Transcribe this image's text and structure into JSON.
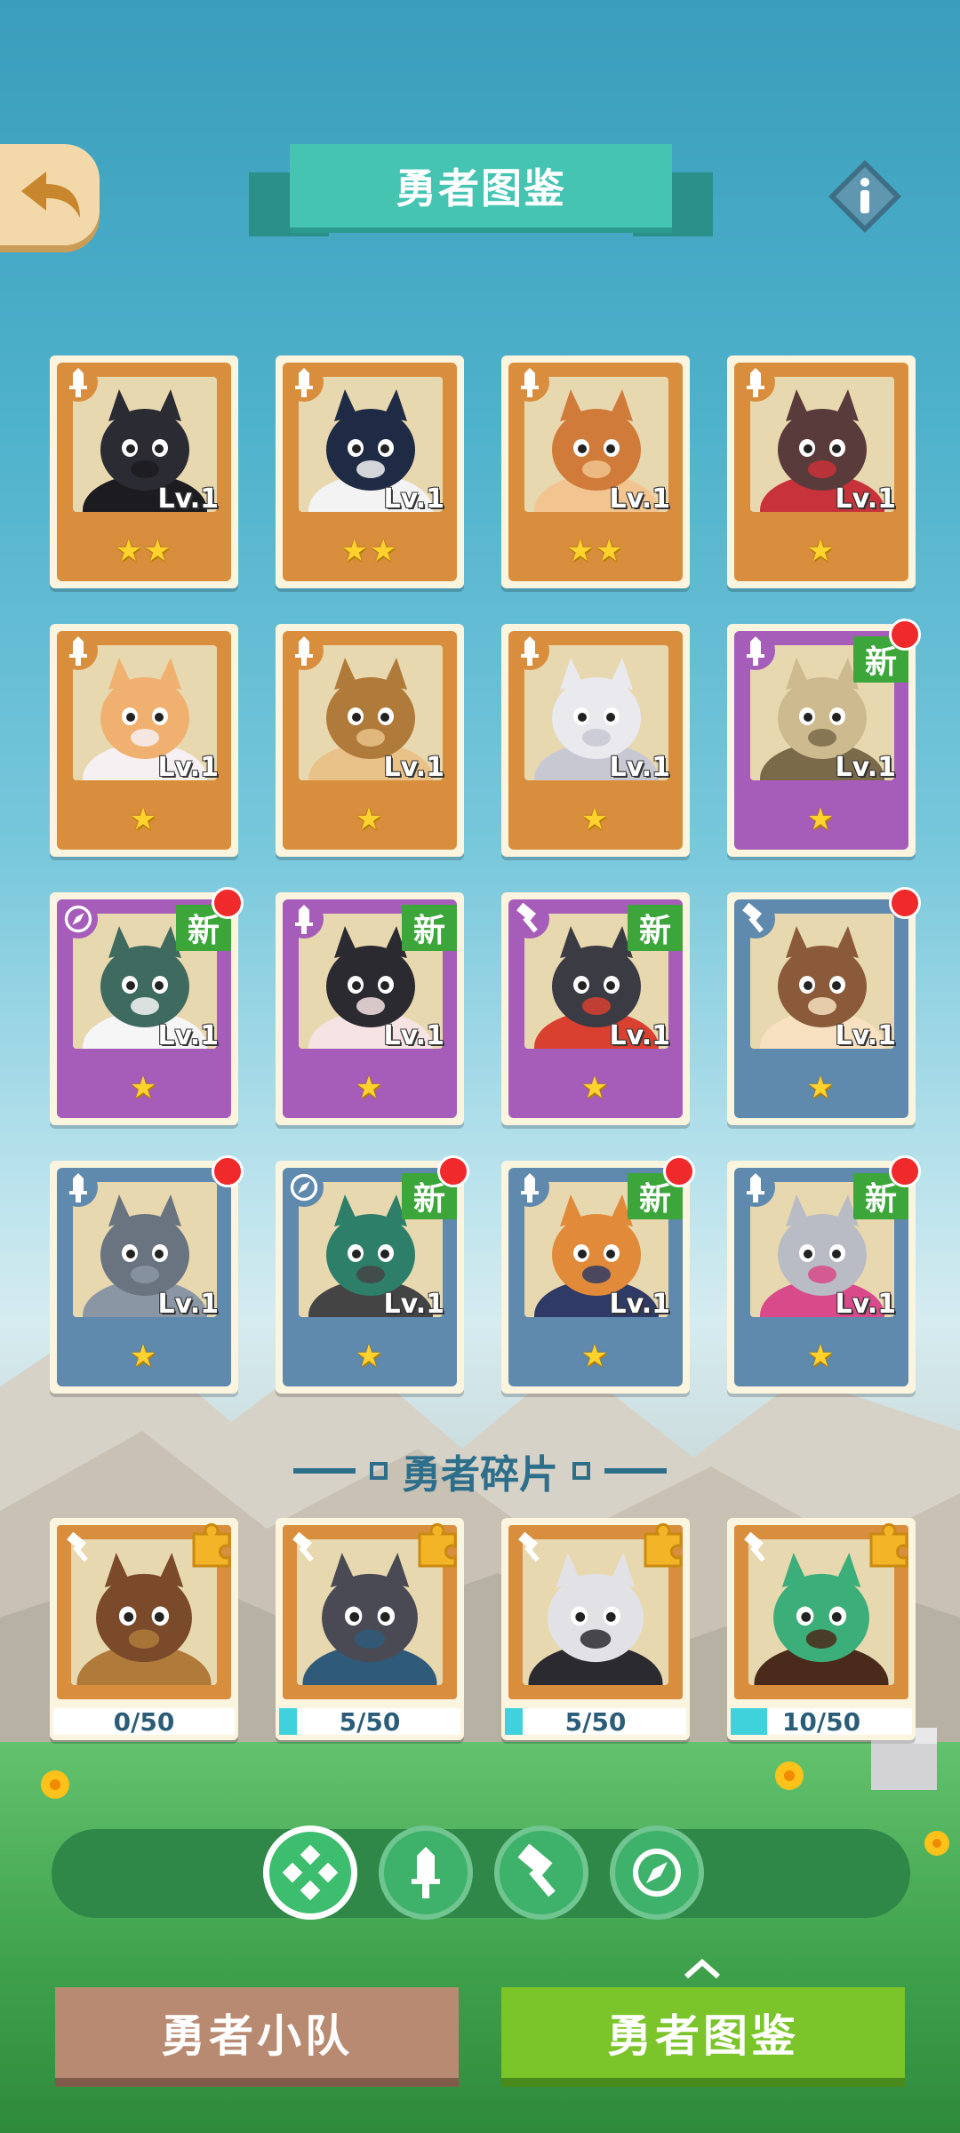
{
  "header": {
    "title": "勇者图鉴",
    "back_icon": "back-arrow-icon",
    "info_icon": "info-icon"
  },
  "heroes": [
    {
      "class": "sword",
      "rarity": "orange",
      "level": "Lv.1",
      "stars": "★★",
      "new": "",
      "dot": false,
      "portrait": "black-goat"
    },
    {
      "class": "sword",
      "rarity": "orange",
      "level": "Lv.1",
      "stars": "★★",
      "new": "",
      "dot": false,
      "portrait": "penguin-hat"
    },
    {
      "class": "sword",
      "rarity": "orange",
      "level": "Lv.1",
      "stars": "★★",
      "new": "",
      "dot": false,
      "portrait": "monkey-king"
    },
    {
      "class": "sword",
      "rarity": "orange",
      "level": "Lv.1",
      "stars": "★",
      "new": "",
      "dot": false,
      "portrait": "horned-warrior"
    },
    {
      "class": "sword",
      "rarity": "orange",
      "level": "Lv.1",
      "stars": "★",
      "new": "",
      "dot": false,
      "portrait": "rabbit-girl"
    },
    {
      "class": "sword",
      "rarity": "orange",
      "level": "Lv.1",
      "stars": "★",
      "new": "",
      "dot": false,
      "portrait": "lynx"
    },
    {
      "class": "sword",
      "rarity": "orange",
      "level": "Lv.1",
      "stars": "★",
      "new": "",
      "dot": false,
      "portrait": "white-wolf"
    },
    {
      "class": "sword",
      "rarity": "purple",
      "level": "Lv.1",
      "stars": "★",
      "new": "新",
      "dot": true,
      "portrait": "deer-beast"
    },
    {
      "class": "compass",
      "rarity": "purple",
      "level": "Lv.1",
      "stars": "★",
      "new": "新",
      "dot": true,
      "portrait": "duck-knights"
    },
    {
      "class": "sword",
      "rarity": "purple",
      "level": "Lv.1",
      "stars": "★",
      "new": "新",
      "dot": false,
      "portrait": "nun-sheep"
    },
    {
      "class": "hammer",
      "rarity": "purple",
      "level": "Lv.1",
      "stars": "★",
      "new": "新",
      "dot": false,
      "portrait": "dark-cat"
    },
    {
      "class": "hammer",
      "rarity": "blue",
      "level": "Lv.1",
      "stars": "★",
      "new": "",
      "dot": true,
      "portrait": "hooded-cat"
    },
    {
      "class": "sword",
      "rarity": "blue",
      "level": "Lv.1",
      "stars": "★",
      "new": "",
      "dot": true,
      "portrait": "mouse"
    },
    {
      "class": "compass",
      "rarity": "blue",
      "level": "Lv.1",
      "stars": "★",
      "new": "新",
      "dot": true,
      "portrait": "frog"
    },
    {
      "class": "sword",
      "rarity": "blue",
      "level": "Lv.1",
      "stars": "★",
      "new": "新",
      "dot": true,
      "portrait": "shiba-police"
    },
    {
      "class": "sword",
      "rarity": "blue",
      "level": "Lv.1",
      "stars": "★",
      "new": "新",
      "dot": true,
      "portrait": "gray-cat"
    }
  ],
  "fragments_section": {
    "title": "勇者碎片",
    "items": [
      {
        "class": "hammer",
        "progress": "0/50",
        "fraction": 0.0,
        "portrait": "lion"
      },
      {
        "class": "hammer",
        "progress": "5/50",
        "fraction": 0.1,
        "portrait": "general"
      },
      {
        "class": "hammer",
        "progress": "5/50",
        "fraction": 0.1,
        "portrait": "gorilla"
      },
      {
        "class": "hammer",
        "progress": "10/50",
        "fraction": 0.2,
        "portrait": "crocodile"
      }
    ]
  },
  "filters": [
    {
      "name": "all",
      "icon": "grid-diamond-icon",
      "active": true
    },
    {
      "name": "sword",
      "icon": "sword-icon",
      "active": false
    },
    {
      "name": "hammer",
      "icon": "hammer-icon",
      "active": false
    },
    {
      "name": "compass",
      "icon": "compass-icon",
      "active": false
    }
  ],
  "bottom_tabs": {
    "team_label": "勇者小队",
    "codex_label": "勇者图鉴"
  },
  "colors": {
    "orange_frame": "#d98e3e",
    "purple_frame": "#a65db9",
    "blue_frame": "#5f89ad",
    "new_badge": "#3ca63a",
    "dot": "#f02a2a"
  }
}
